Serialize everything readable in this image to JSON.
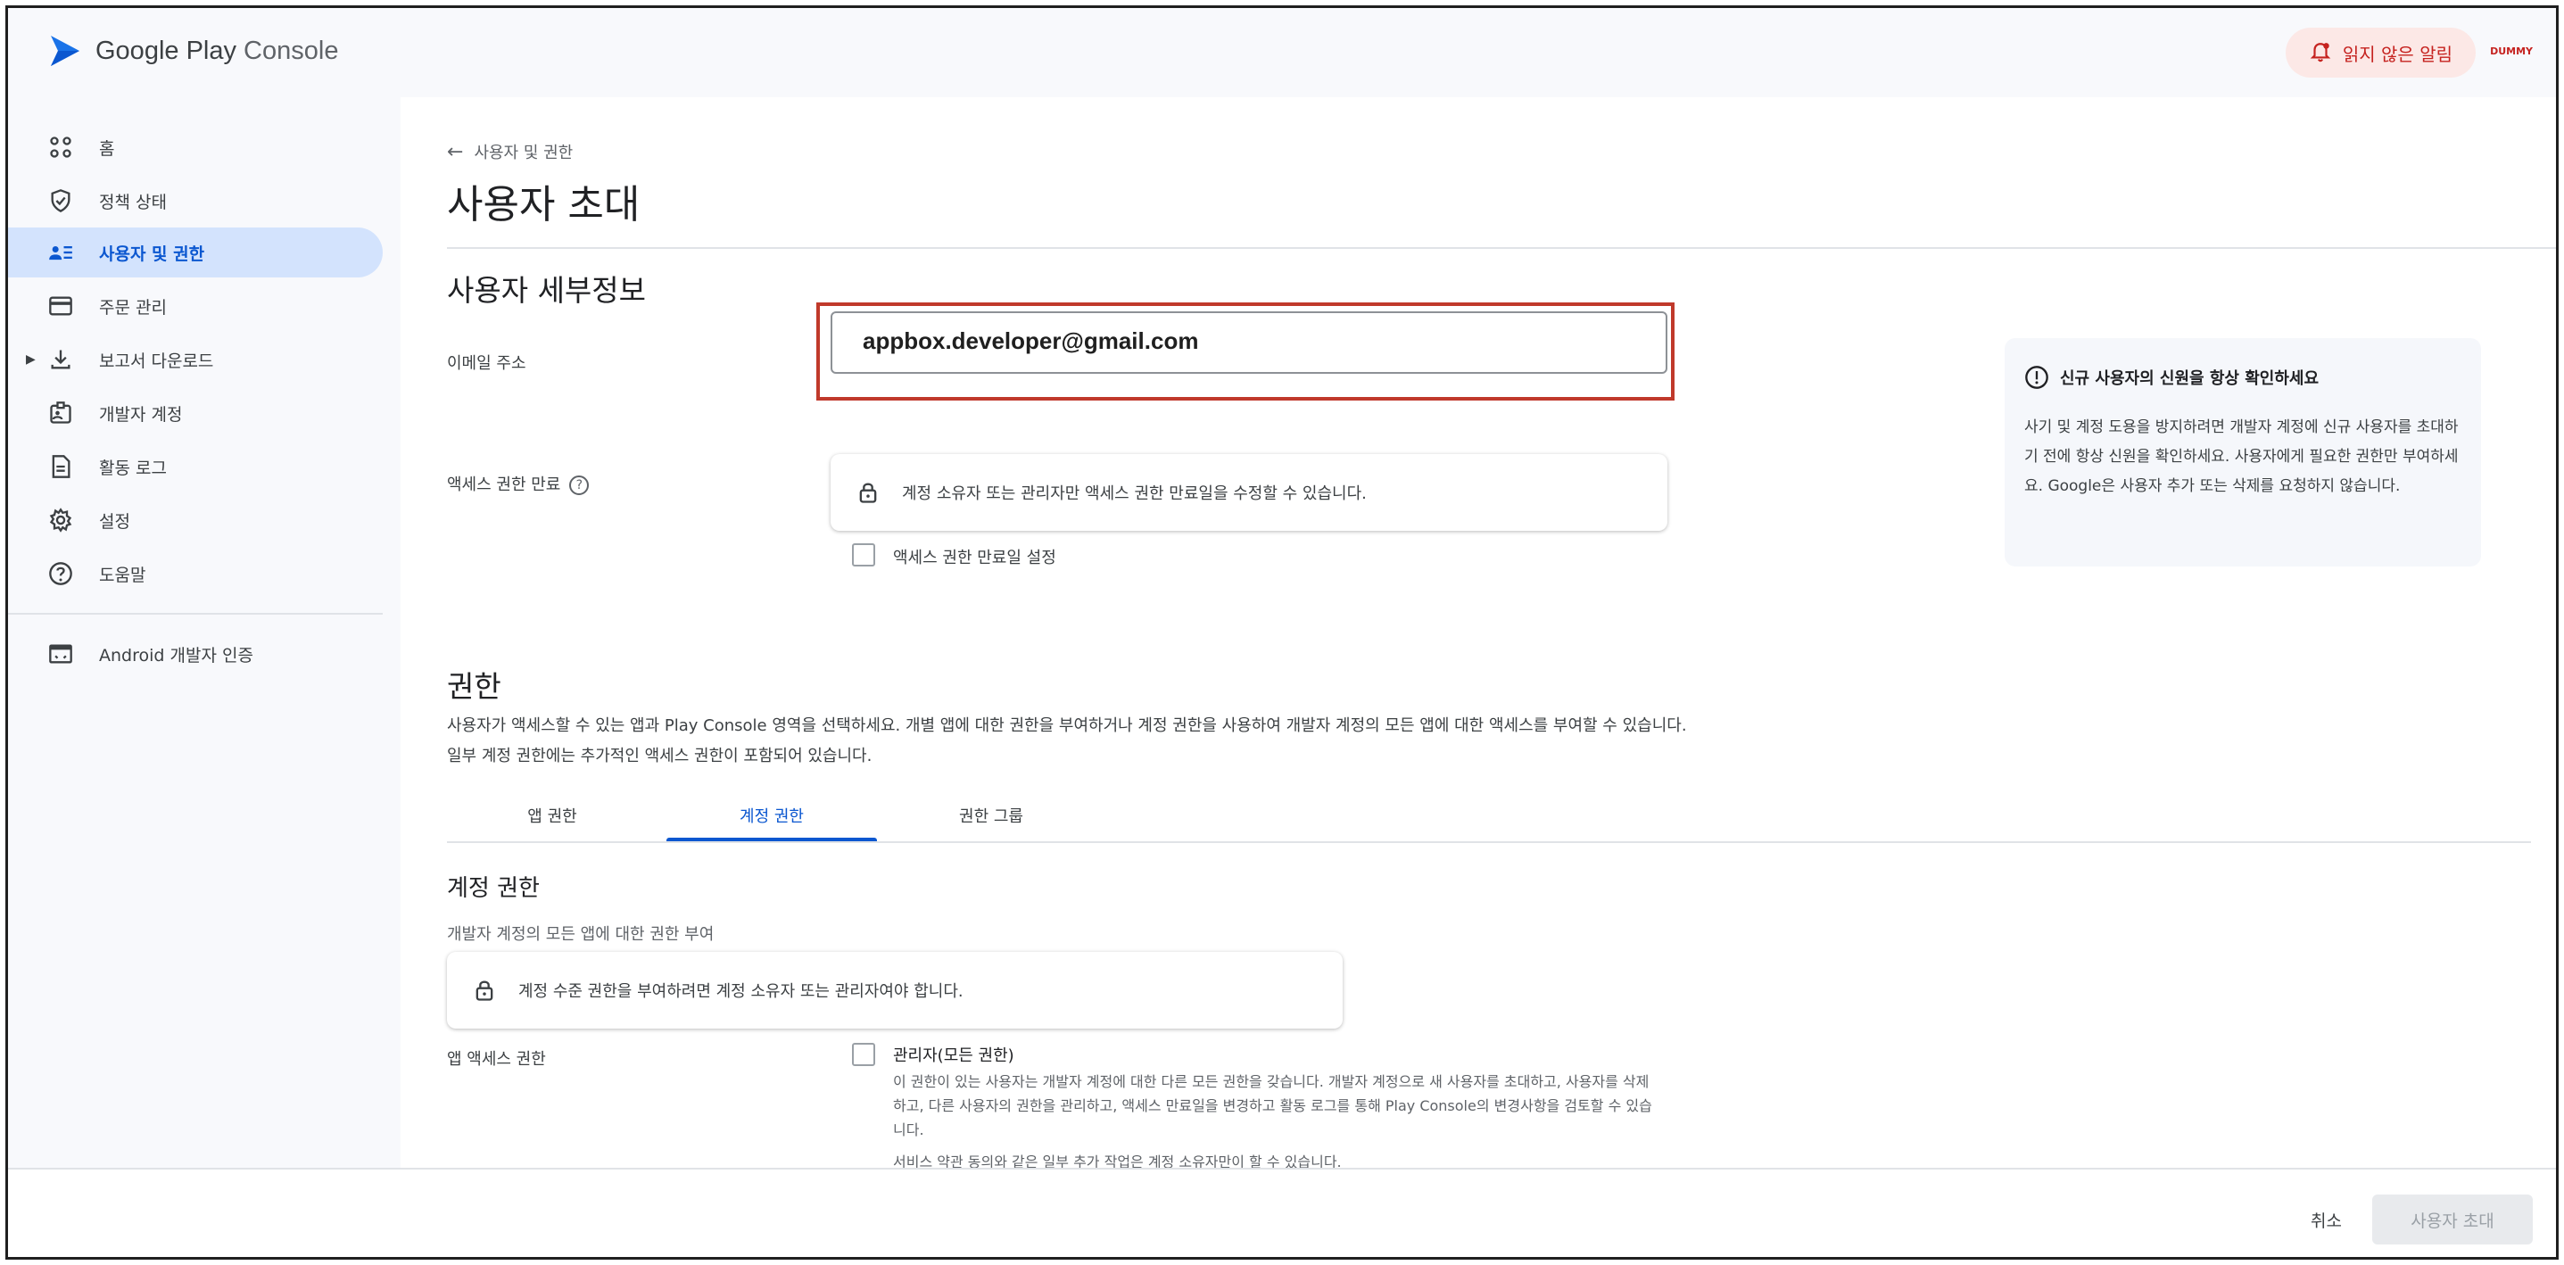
{
  "app": {
    "logo_brand": "Google Play",
    "logo_product": " Console",
    "notification_label": "읽지 않은 알림",
    "account_badge": "DUMMY"
  },
  "sidebar": {
    "items": [
      {
        "label": "홈",
        "icon": "grid-icon"
      },
      {
        "label": "정책 상태",
        "icon": "shield-check-icon"
      },
      {
        "label": "사용자 및 권한",
        "icon": "users-list-icon"
      },
      {
        "label": "주문 관리",
        "icon": "credit-card-icon"
      },
      {
        "label": "보고서 다운로드",
        "icon": "download-icon"
      },
      {
        "label": "개발자 계정",
        "icon": "id-card-icon"
      },
      {
        "label": "활동 로그",
        "icon": "document-icon"
      },
      {
        "label": "설정",
        "icon": "gear-icon"
      },
      {
        "label": "도움말",
        "icon": "help-icon"
      }
    ],
    "extra": {
      "label": "Android 개발자 인증",
      "icon": "window-icon"
    }
  },
  "page": {
    "back_label": "사용자 및 권한",
    "title": "사용자 초대",
    "details_heading": "사용자 세부정보",
    "email_label": "이메일 주소",
    "email_value": "appbox.developer@gmail.com",
    "expiry_label": "액세스 권한 만료",
    "expiry_notice": "계정 소유자 또는 관리자만 액세스 권한 만료일을 수정할 수 있습니다.",
    "expiry_checkbox_label": "액세스 권한 만료일 설정",
    "info_title": "신규 사용자의 신원을 항상 확인하세요",
    "info_body": "사기 및 계정 도용을 방지하려면 개발자 계정에 신규 사용자를 초대하기 전에 항상 신원을 확인하세요. 사용자에게 필요한 권한만 부여하세요. Google은 사용자 추가 또는 삭제를 요청하지 않습니다.",
    "permissions_heading": "권한",
    "permissions_desc": "사용자가 액세스할 수 있는 앱과 Play Console 영역을 선택하세요. 개별 앱에 대한 권한을 부여하거나 계정 권한을 사용하여 개발자 계정의 모든 앱에 대한 액세스를 부여할 수 있습니다. 일부 계정 권한에는 추가적인 액세스 권한이 포함되어 있습니다.",
    "tabs": [
      "앱 권한",
      "계정 권한",
      "권한 그룹"
    ],
    "account_perm_heading": "계정 권한",
    "account_perm_subtitle": "개발자 계정의 모든 앱에 대한 권한 부여",
    "account_perm_notice": "계정 수준 권한을 부여하려면 계정 소유자 또는 관리자여야 합니다.",
    "app_access_label": "앱 액세스 권한",
    "admin_title": "관리자(모든 권한)",
    "admin_desc": "이 권한이 있는 사용자는 개발자 계정에 대한 다른 모든 권한을 갖습니다. 개발자 계정으로 새 사용자를 초대하고, 사용자를 삭제하고, 다른 사용자의 권한을 관리하고, 액세스 만료일을 변경하고 활동 로그를 통해 Play Console의 변경사항을 검토할 수 있습니다.",
    "admin_desc2": "서비스 약관 동의와 같은 일부 추가 작업은 계정 소유자만이 할 수 있습니다."
  },
  "footer": {
    "cancel_label": "취소",
    "invite_label": "사용자 초대"
  },
  "colors": {
    "accent": "#0b57d0",
    "active_nav_bg": "#d3e3fd",
    "highlight_border": "#c0392b",
    "notification_bg": "#fce8e6"
  }
}
